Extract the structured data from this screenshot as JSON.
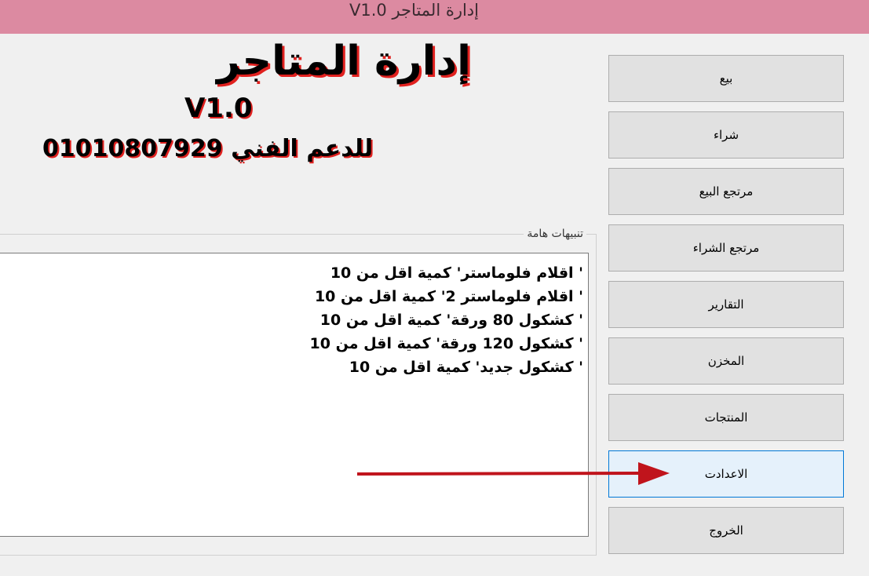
{
  "window": {
    "title": "إدارة المتاجر V1.0"
  },
  "logo": {
    "line1": "إدارة المتاجر",
    "version": "V1.0",
    "support": "للدعم الفني 01010807929"
  },
  "alerts": {
    "group_title": "تنبيهات هامة",
    "items": [
      "' اقلام فلوماستر'  كمية اقل من 10",
      "' اقلام فلوماستر 2'  كمية اقل من 10",
      "' كشكول 80 ورقة'  كمية اقل من 10",
      "' كشكول 120 ورقة'  كمية اقل من 10",
      "' كشكول جديد'  كمية اقل من 10"
    ]
  },
  "nav": {
    "buttons": [
      {
        "label": "بيع"
      },
      {
        "label": "شراء"
      },
      {
        "label": "مرتجع البيع"
      },
      {
        "label": "مرتجع الشراء"
      },
      {
        "label": "التقارير"
      },
      {
        "label": "المخزن"
      },
      {
        "label": "المنتجات"
      },
      {
        "label": "الاعدادت"
      },
      {
        "label": "الخروج"
      }
    ],
    "active_index": 7
  },
  "colors": {
    "titlebar": "#dc8aa1",
    "arrow": "#c0141c",
    "logo_shadow": "#e0211f"
  }
}
